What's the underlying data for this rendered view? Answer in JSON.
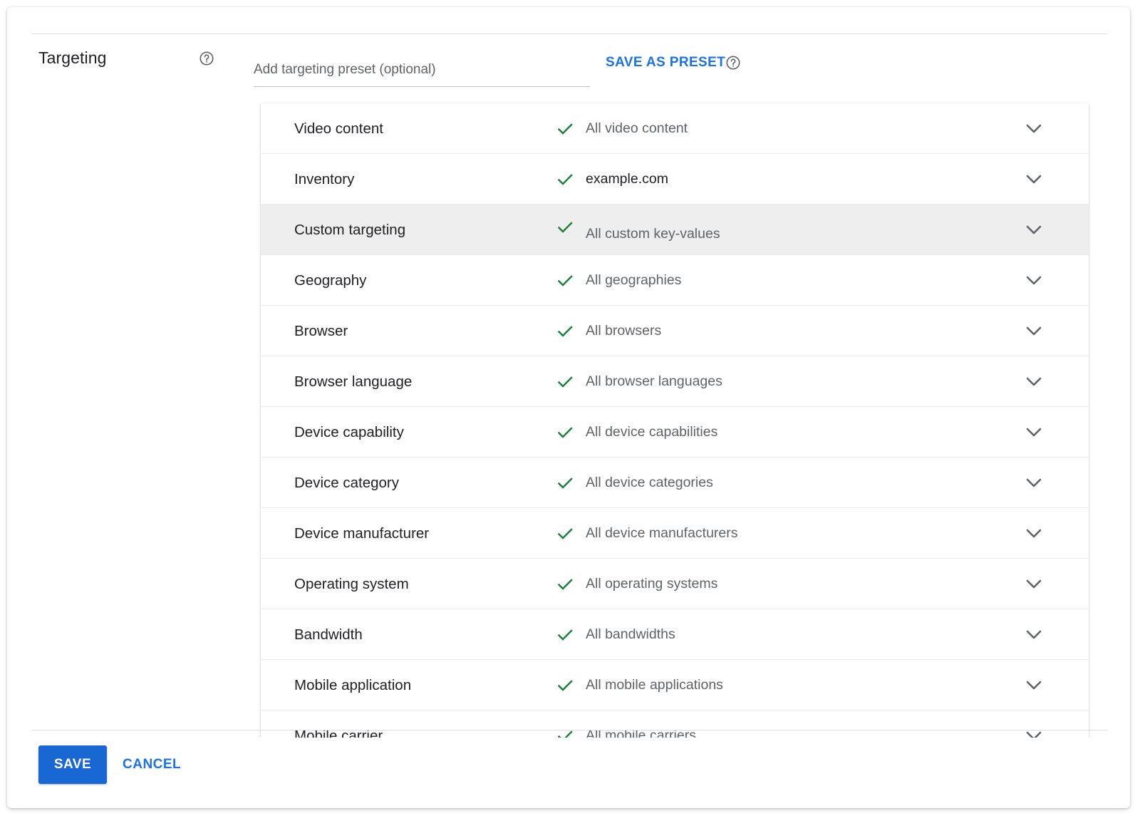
{
  "section": {
    "title": "Targeting"
  },
  "preset": {
    "placeholder": "Add targeting preset (optional)",
    "value": "",
    "save_label": "SAVE AS PRESET"
  },
  "targeting_rows": [
    {
      "label": "Video content",
      "value": "All video content",
      "value_emphasis": false,
      "highlighted": false
    },
    {
      "label": "Inventory",
      "value": "example.com",
      "value_emphasis": true,
      "highlighted": false
    },
    {
      "label": "Custom targeting",
      "value": "All custom key-values",
      "value_emphasis": false,
      "highlighted": true
    },
    {
      "label": "Geography",
      "value": "All geographies",
      "value_emphasis": false,
      "highlighted": false
    },
    {
      "label": "Browser",
      "value": "All browsers",
      "value_emphasis": false,
      "highlighted": false
    },
    {
      "label": "Browser language",
      "value": "All browser languages",
      "value_emphasis": false,
      "highlighted": false
    },
    {
      "label": "Device capability",
      "value": "All device capabilities",
      "value_emphasis": false,
      "highlighted": false
    },
    {
      "label": "Device category",
      "value": "All device categories",
      "value_emphasis": false,
      "highlighted": false
    },
    {
      "label": "Device manufacturer",
      "value": "All device manufacturers",
      "value_emphasis": false,
      "highlighted": false
    },
    {
      "label": "Operating system",
      "value": "All operating systems",
      "value_emphasis": false,
      "highlighted": false
    },
    {
      "label": "Bandwidth",
      "value": "All bandwidths",
      "value_emphasis": false,
      "highlighted": false
    },
    {
      "label": "Mobile application",
      "value": "All mobile applications",
      "value_emphasis": false,
      "highlighted": false
    },
    {
      "label": "Mobile carrier",
      "value": "All mobile carriers",
      "value_emphasis": false,
      "highlighted": false
    }
  ],
  "icons": {
    "help": "help-circle-icon",
    "check": "checkmark-icon",
    "expand": "chevron-down-icon"
  },
  "colors": {
    "accent": "#1a73e8",
    "save_button": "#1967d2",
    "check": "#188038",
    "highlight_row": "#eeeeee"
  },
  "actions": {
    "save_label": "SAVE",
    "cancel_label": "CANCEL"
  }
}
